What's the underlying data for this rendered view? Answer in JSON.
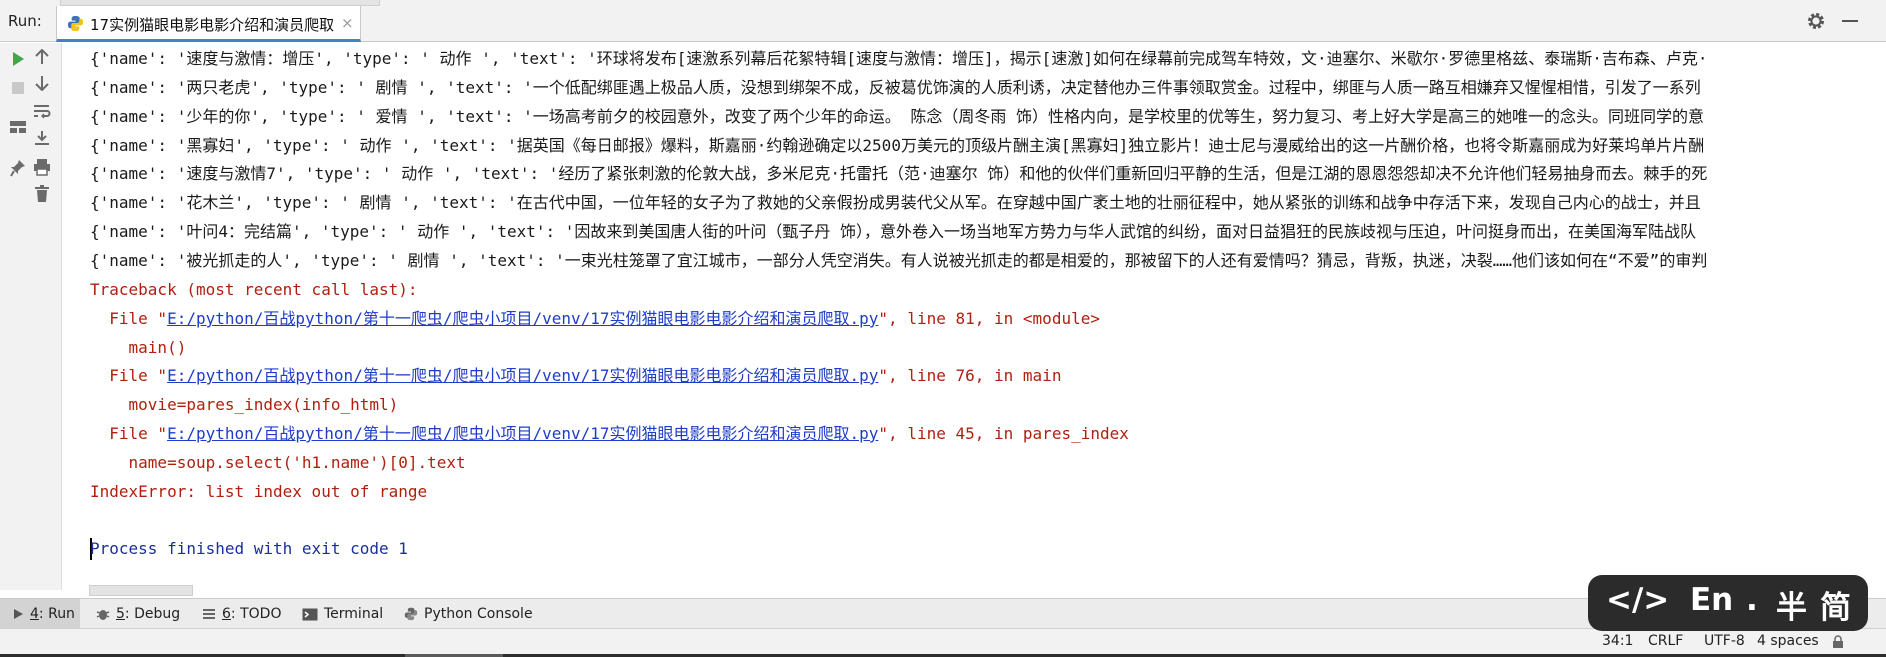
{
  "run_window": {
    "label": "Run:",
    "tab_title": "17实例猫眼电影电影介绍和演员爬取",
    "tab_close": "×",
    "icons": [
      "python-file-icon",
      "gear-icon",
      "minimize-icon"
    ]
  },
  "toolbar": {
    "buttons": [
      "rerun-icon",
      "stop-icon",
      "layout-icon",
      "pin-icon",
      "up-arrow-icon",
      "down-arrow-icon",
      "soft-wrap-icon",
      "scroll-to-end-icon",
      "print-icon",
      "trash-icon"
    ]
  },
  "console": {
    "output_lines": [
      "{'name': '速度与激情：增压', 'type': ' 动作 ', 'text': '环球将发布[速激系列幕后花絮特辑[速度与激情：增压]，揭示[速激]如何在绿幕前完成驾车特效，文·迪塞尔、米歇尔·罗德里格兹、泰瑞斯·吉布森、卢克·",
      "{'name': '两只老虎', 'type': ' 剧情 ', 'text': '一个低配绑匪遇上极品人质，没想到绑架不成，反被葛优饰演的人质利诱，决定替他办三件事领取赏金。过程中，绑匪与人质一路互相嫌弃又惺惺相惜，引发了一系列",
      "{'name': '少年的你', 'type': ' 爱情 ', 'text': '一场高考前夕的校园意外，改变了两个少年的命运。 陈念（周冬雨 饰）性格内向，是学校里的优等生，努力复习、考上好大学是高三的她唯一的念头。同班同学的意",
      "{'name': '黑寡妇', 'type': ' 动作 ', 'text': '据英国《每日邮报》爆料，斯嘉丽·约翰逊确定以2500万美元的顶级片酬主演[黑寡妇]独立影片！迪士尼与漫威给出的这一片酬价格，也将令斯嘉丽成为好莱坞单片片酬",
      "{'name': '速度与激情7', 'type': ' 动作 ', 'text': '经历了紧张刺激的伦敦大战，多米尼克·托雷托（范·迪塞尔 饰）和他的伙伴们重新回归平静的生活，但是江湖的恩恩怨怨却决不允许他们轻易抽身而去。棘手的死",
      "{'name': '花木兰', 'type': ' 剧情 ', 'text': '在古代中国，一位年轻的女子为了救她的父亲假扮成男装代父从军。在穿越中国广袤土地的壮丽征程中，她从紧张的训练和战争中存活下来，发现自己内心的战士，并且",
      "{'name': '叶问4：完结篇', 'type': ' 动作 ', 'text': '因故来到美国唐人街的叶问（甄子丹 饰），意外卷入一场当地军方势力与华人武馆的纠纷，面对日益猖狂的民族歧视与压迫，叶问挺身而出，在美国海军陆战队",
      "{'name': '被光抓走的人', 'type': ' 剧情 ', 'text': '一束光柱笼罩了宜江城市，一部分人凭空消失。有人说被光抓走的都是相爱的，那被留下的人还有爱情吗？猜忌，背叛，执迷，决裂……他们该如何在“不爱”的审判"
    ],
    "traceback_header": "Traceback (most recent call last):",
    "frames": [
      {
        "prefix": "  File \"",
        "path": "E:/python/百战python/第十一爬虫/爬虫小项目/venv/17实例猫眼电影电影介绍和演员爬取.py",
        "suffix": "\", line 81, in <module>",
        "code": "    main()"
      },
      {
        "prefix": "  File \"",
        "path": "E:/python/百战python/第十一爬虫/爬虫小项目/venv/17实例猫眼电影电影介绍和演员爬取.py",
        "suffix": "\", line 76, in main",
        "code": "    movie=pares_index(info_html)"
      },
      {
        "prefix": "  File \"",
        "path": "E:/python/百战python/第十一爬虫/爬虫小项目/venv/17实例猫眼电影电影介绍和演员爬取.py",
        "suffix": "\", line 45, in pares_index",
        "code": "    name=soup.select('h1.name')[0].text"
      }
    ],
    "error": "IndexError: list index out of range",
    "exit_message": "Process finished with exit code 1"
  },
  "tool_tabs": [
    {
      "key": "4",
      "label": ": Run",
      "icon": "run-icon"
    },
    {
      "key": "5",
      "label": ": Debug",
      "icon": "bug-icon"
    },
    {
      "key": "6",
      "label": ": TODO",
      "icon": "list-icon"
    },
    {
      "key": "",
      "label": "Terminal",
      "icon": "terminal-icon"
    },
    {
      "key": "",
      "label": "Python Console",
      "icon": "python-console-icon"
    }
  ],
  "status_bar": {
    "position": "34:1",
    "line_sep": "CRLF",
    "encoding": "UTF-8",
    "indent": "4 spaces"
  },
  "ime_overlay": {
    "code_symbol": "</>",
    "lang": "En",
    "dot": ".",
    "width_mode": "半",
    "script": "简"
  },
  "colors": {
    "accent": "#4083c9",
    "error": "#b0200e",
    "link": "#1e3cc8",
    "exit": "#1a2f9c",
    "run_green": "#3fa84a"
  }
}
